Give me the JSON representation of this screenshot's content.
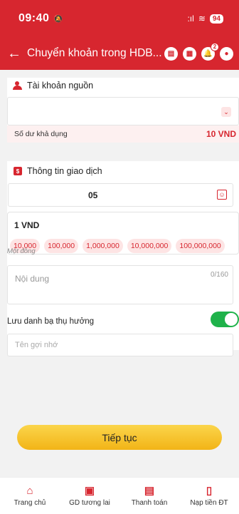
{
  "status_bar": {
    "time": "09:40",
    "mute_glyph": "🔕",
    "signal": ":ıl",
    "wifi": "≋",
    "battery": "94"
  },
  "header": {
    "back_glyph": "←",
    "title": "Chuyển khoản trong HDB...",
    "notification_badge": "2"
  },
  "source": {
    "title": "Tài khoản nguồn",
    "balance_label": "Số dư khả dụng",
    "balance_value": "10 VND"
  },
  "transaction": {
    "title": "Thông tin giao dịch",
    "account_number": "05",
    "amount": "1 VND",
    "quick_amounts": [
      "10,000",
      "100,000",
      "1,000,000",
      "10,000,000",
      "100,000,000"
    ],
    "amount_in_words": "Một đồng",
    "content_placeholder": "Nội dung",
    "content_counter": "0/160",
    "save_label": "Lưu danh bạ thụ hưởng",
    "nickname_placeholder": "Tên gợi nhớ"
  },
  "continue_label": "Tiếp tục",
  "tabs": [
    {
      "label": "Trang chủ",
      "icon": "home-icon"
    },
    {
      "label": "GD tương lai",
      "icon": "future-transaction-icon"
    },
    {
      "label": "Thanh toán",
      "icon": "bill-payment-icon"
    },
    {
      "label": "Nạp tiền ĐT",
      "icon": "mobile-topup-icon"
    }
  ],
  "colors": {
    "brand": "#d7262f",
    "accent": "#f2b417",
    "toggle_on": "#1fb24a"
  }
}
